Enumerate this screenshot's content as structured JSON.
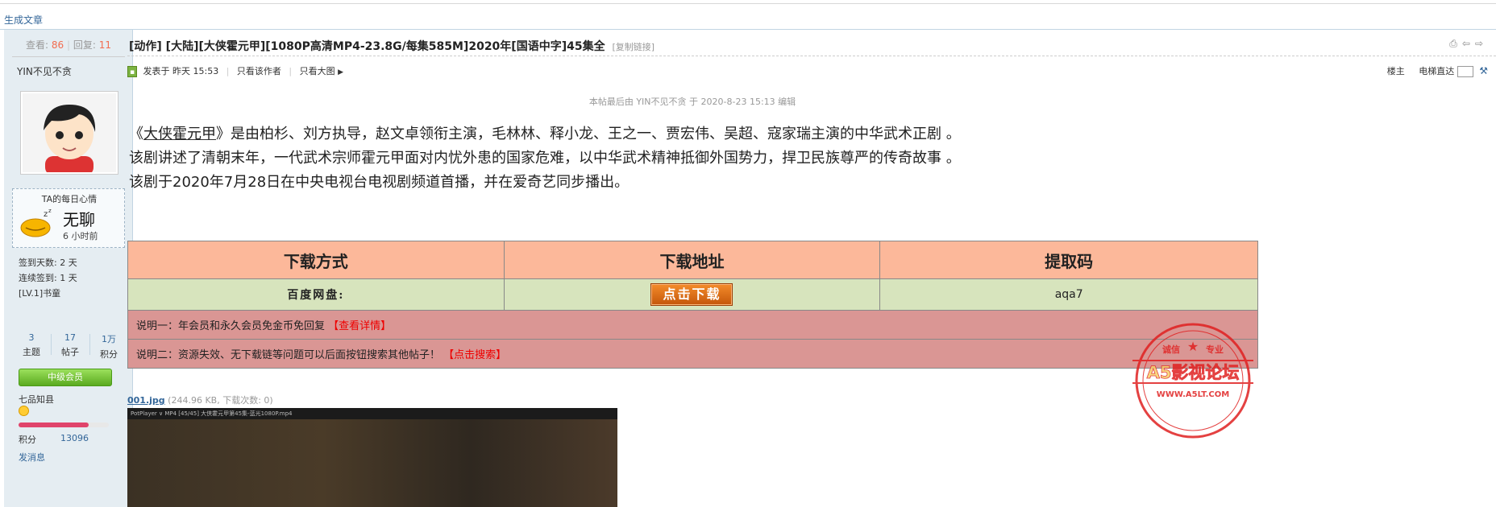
{
  "top": {
    "generate_link": "生成文章"
  },
  "sidebar": {
    "views_label": "查看:",
    "views": "86",
    "replies_label": "回复:",
    "replies": "11",
    "username": "YIN不见不贪",
    "mood": {
      "title": "TA的每日心情",
      "word": "无聊",
      "time": "6 小时前"
    },
    "checkin_days": "签到天数: 2 天",
    "streak": "连续签到: 1 天",
    "level": "[LV.1]书童",
    "counts": [
      {
        "value": "3",
        "label": "主题"
      },
      {
        "value": "17",
        "label": "帖子"
      },
      {
        "value": "1万",
        "label": "积分"
      }
    ],
    "member_badge": "中级会员",
    "rank": "七品知县",
    "progress": 0.78,
    "points_label": "积分",
    "points_value": "13096",
    "more": "发消息"
  },
  "post": {
    "title": "[动作] [大陆][大侠霍元甲][1080P高清MP4-23.8G/每集585M]2020年[国语中字]45集全",
    "copy_link": "[复制链接]",
    "meta": {
      "posted": "发表于 昨天 15:53",
      "only_author": "只看该作者",
      "big_image": "只看大图",
      "floor": "楼主",
      "jump": "电梯直达"
    },
    "edit_note": "本帖最后由 YIN不见不贪 于 2020-8-23 15:13 编辑",
    "para1_open": "《",
    "para1_link": "大侠霍元甲",
    "para1_rest": "》是由柏杉、刘方执导，赵文卓领衔主演，毛林林、释小龙、王之一、贾宏伟、吴超、寇家瑞主演的中华武术正剧 。",
    "para2": "该剧讲述了清朝末年，一代武术宗师霍元甲面对内忧外患的国家危难，以中华武术精神抵御外国势力，捍卫民族尊严的传奇故事 。",
    "para3": "该剧于2020年7月28日在中央电视台电视剧频道首播，并在爱奇艺同步播出。"
  },
  "download": {
    "headers": [
      "下载方式",
      "下载地址",
      "提取码"
    ],
    "method": "百度网盘:",
    "button": "点击下载",
    "code": "aqa7",
    "note1_text": "说明一：年会员和永久会员免金币免回复 ",
    "note1_link": "【查看详情】",
    "note2_text": "说明二：资源失效、无下载链等问题可以后面按钮搜索其他帖子！ ",
    "note2_link": "【点击搜索】"
  },
  "stamp": {
    "top_left": "诚信",
    "top_right": "专业",
    "name": "A5影视论坛",
    "url": "WWW.A5LT.COM",
    "color": "#e02020"
  },
  "attachment": {
    "filename": "001.jpg",
    "info": "(244.96 KB, 下载次数: 0)",
    "player_title": "PotPlayer ∨   MP4   [45/45] 大侠霍元甲第45集-蓝光1080P.mp4"
  }
}
